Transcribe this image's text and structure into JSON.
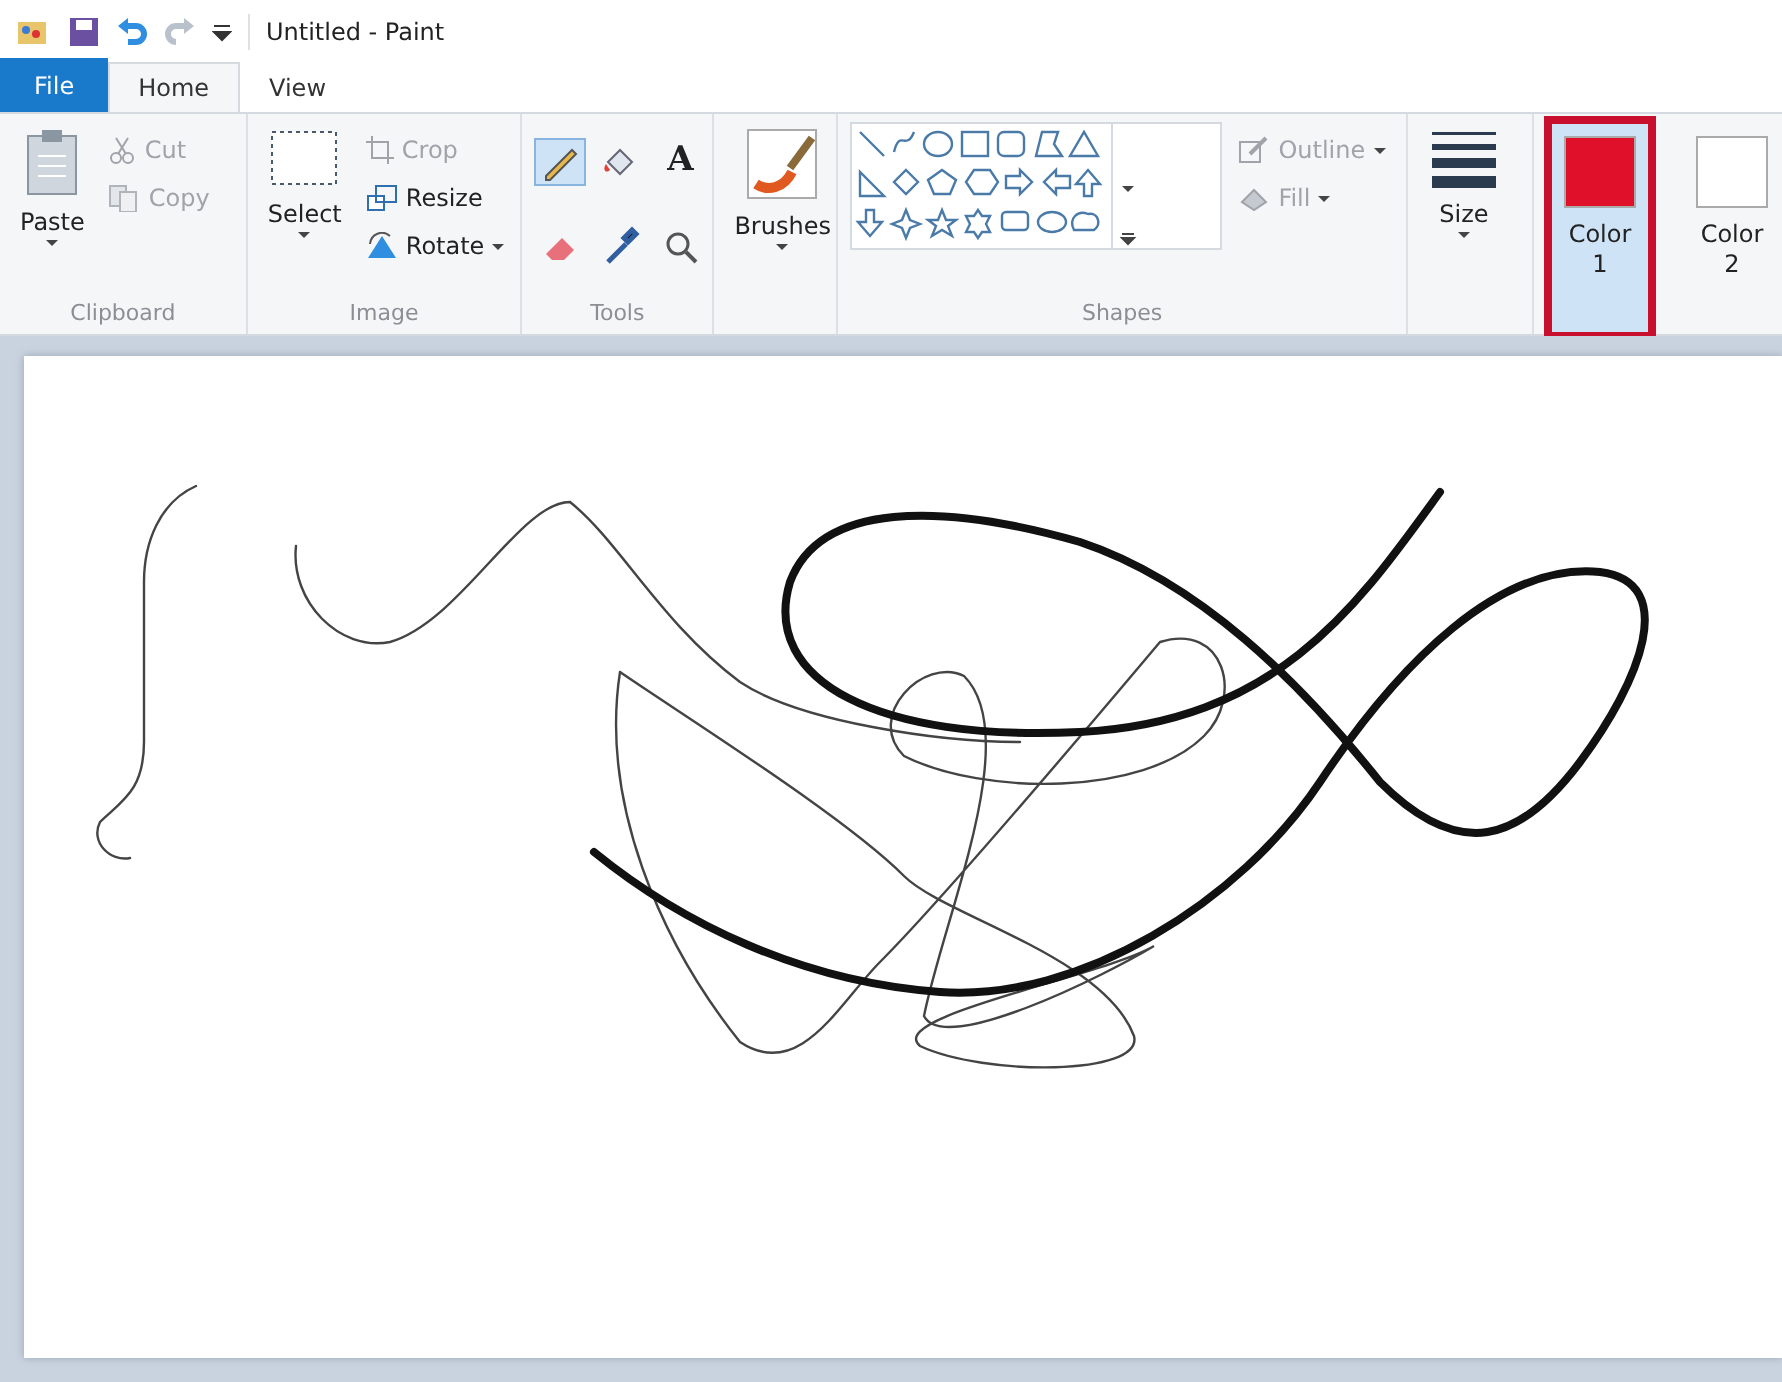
{
  "window": {
    "title": "Untitled - Paint"
  },
  "tabs": [
    {
      "label": "File",
      "selected": false,
      "kind": "file"
    },
    {
      "label": "Home",
      "selected": true,
      "kind": "tab"
    },
    {
      "label": "View",
      "selected": false,
      "kind": "tab"
    }
  ],
  "ribbon": {
    "clipboard": {
      "paste": "Paste",
      "cut": {
        "label": "Cut",
        "disabled": true
      },
      "copy": {
        "label": "Copy",
        "disabled": true
      },
      "group_label": "Clipboard"
    },
    "image": {
      "select": "Select",
      "crop": {
        "label": "Crop",
        "disabled": true
      },
      "resize": {
        "label": "Resize",
        "disabled": false
      },
      "rotate": {
        "label": "Rotate",
        "disabled": false
      },
      "group_label": "Image"
    },
    "tools": {
      "items": [
        {
          "kind": "pencil",
          "selected": true
        },
        {
          "kind": "fill",
          "selected": false
        },
        {
          "kind": "text",
          "selected": false
        },
        {
          "kind": "eraser",
          "selected": false
        },
        {
          "kind": "picker",
          "selected": false
        },
        {
          "kind": "magnifier",
          "selected": false
        }
      ],
      "text_glyph": "A",
      "group_label": "Tools"
    },
    "brushes": {
      "label": "Brushes"
    },
    "shapes": {
      "outline": {
        "label": "Outline",
        "disabled": true
      },
      "fill": {
        "label": "Fill",
        "disabled": true
      },
      "group_label": "Shapes"
    },
    "size": {
      "label": "Size"
    },
    "colors": [
      {
        "label": "Color",
        "sub": "1",
        "color": "#e0102a",
        "selected": true
      },
      {
        "label": "Color",
        "sub": "2",
        "color": "#ffffff",
        "selected": false
      }
    ]
  }
}
